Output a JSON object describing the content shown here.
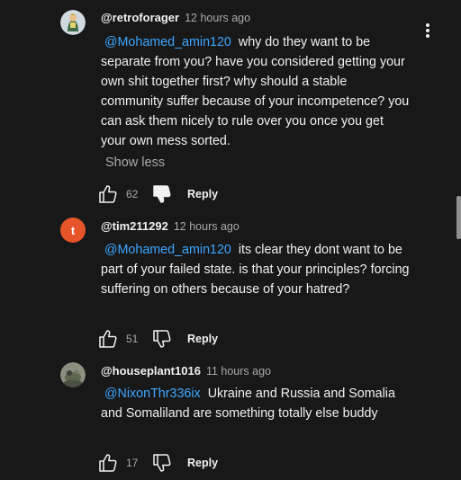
{
  "comments": [
    {
      "handle": "@retroforager",
      "time": "12 hours ago",
      "mention": "@Mohamed_amin120",
      "text": "why do they want to be separate from you? have you considered getting your own shit together first? why should a stable community suffer because of your incompetence? you can ask them nicely to rule over you once you get your own mess sorted.",
      "show_less": "Show less",
      "likes": "62",
      "reply": "Reply"
    },
    {
      "handle": "@tim211292",
      "avatar_letter": "t",
      "time": "12 hours ago",
      "mention": "@Mohamed_amin120",
      "text": "its clear they dont want to be part of your failed state. is that your principles? forcing suffering on others because of your hatred?",
      "likes": "51",
      "reply": "Reply"
    },
    {
      "handle": "@houseplant1016",
      "time": "11 hours ago",
      "mention": "@NixonThr336ix",
      "text": "Ukraine and Russia and Somalia and Somaliland are something totally else buddy",
      "likes": "17",
      "reply": "Reply"
    }
  ]
}
